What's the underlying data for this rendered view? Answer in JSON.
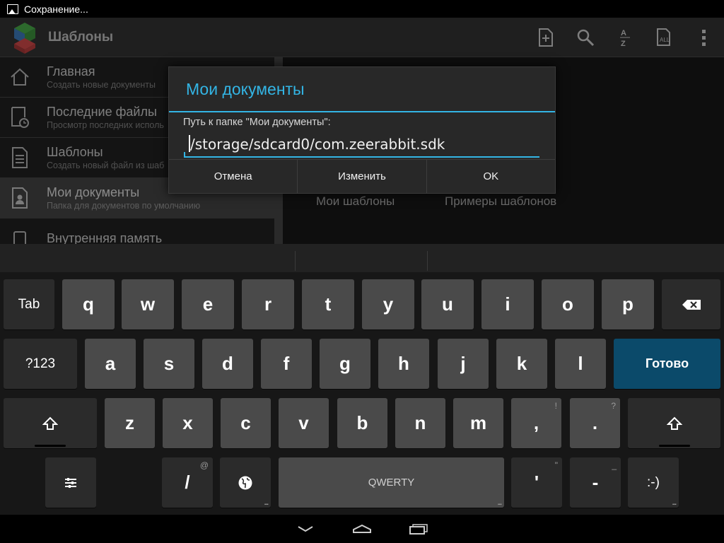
{
  "status_bar": {
    "notification_text": "Сохранение..."
  },
  "action_bar": {
    "title": "Шаблоны",
    "actions": [
      "add-document-icon",
      "search-icon",
      "sort-az-icon",
      "select-all-icon",
      "overflow-menu-icon"
    ]
  },
  "sidebar": {
    "items": [
      {
        "title": "Главная",
        "subtitle": "Создать новые документы",
        "icon": "home-icon"
      },
      {
        "title": "Последние файлы",
        "subtitle": "Просмотр последних исполь",
        "icon": "recent-files-icon"
      },
      {
        "title": "Шаблоны",
        "subtitle": "Создать новый файл из шаб",
        "icon": "template-icon"
      },
      {
        "title": "Мои документы",
        "subtitle": "Папка для документов по умолчанию",
        "icon": "my-documents-icon"
      },
      {
        "title": "Внутренняя память",
        "subtitle": "",
        "icon": "internal-storage-icon"
      }
    ]
  },
  "content": {
    "tabs": [
      "Мои шаблоны",
      "Примеры шаблонов"
    ]
  },
  "dialog": {
    "title": "Мои документы",
    "label": "Путь к папке \"Мои документы\":",
    "path_value": "/storage/sdcard0/com.zeerabbit.sdk",
    "buttons": {
      "cancel": "Отмена",
      "change": "Изменить",
      "ok": "OK"
    }
  },
  "keyboard": {
    "row1": [
      "q",
      "w",
      "e",
      "r",
      "t",
      "y",
      "u",
      "i",
      "o",
      "p"
    ],
    "row2": [
      "a",
      "s",
      "d",
      "f",
      "g",
      "h",
      "j",
      "k",
      "l"
    ],
    "row3": [
      "z",
      "x",
      "c",
      "v",
      "b",
      "n",
      "m",
      ",",
      "."
    ],
    "row3_hints": {
      "comma": "!",
      "period": "?"
    },
    "tab_label": "Tab",
    "symbols_label": "?123",
    "done_label": "Готово",
    "slash_label": "/",
    "slash_hint": "@",
    "space_label": "QWERTY",
    "apostrophe_label": "'",
    "apostrophe_hint": "\"",
    "dash_label": "-",
    "dash_hint": "_",
    "smiley_label": ":-)",
    "colors": {
      "accent": "#33b5e5",
      "done_key": "#0b4a6a"
    }
  },
  "nav_bar": {
    "buttons": [
      "back-icon",
      "home-icon",
      "recent-apps-icon"
    ]
  }
}
